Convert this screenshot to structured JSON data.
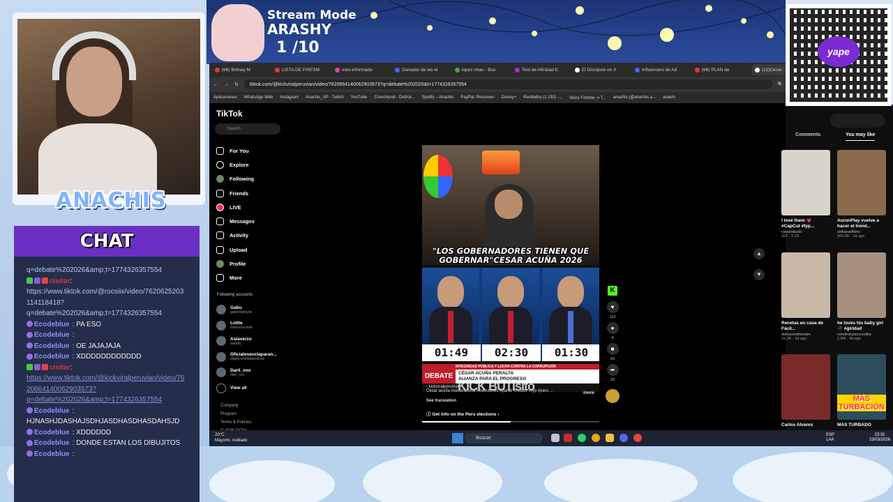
{
  "overlay": {
    "stream_title": "Stream Mode",
    "streamer": "ARASHY",
    "count": "1  /10",
    "name_banner": "ANACHIS",
    "payment_brand": "yape"
  },
  "chat": {
    "title": "CHAT",
    "messages": [
      {
        "user": "",
        "text": "q=debate%202026&amp;t=1774326357554",
        "kind": "link"
      },
      {
        "user": "cisitar",
        "text": ":",
        "kind": "red"
      },
      {
        "user": "",
        "text": "https://www.tiktok.com/@rocsiix/video/7620625203114118418?",
        "kind": "link"
      },
      {
        "user": "",
        "text": "q=debate%202026&amp;t=1774326357554",
        "kind": "link"
      },
      {
        "user": "Ecodeblue",
        "text": ": PA ESO",
        "kind": "normal"
      },
      {
        "user": "Ecodeblue",
        "text": ": ",
        "kind": "normal"
      },
      {
        "user": "Ecodeblue",
        "text": ": OE JAJAJAJA",
        "kind": "normal"
      },
      {
        "user": "Ecodeblue",
        "text": ": XDDDDDDDDDDDD",
        "kind": "normal"
      },
      {
        "user": "cisitar",
        "text": ":",
        "kind": "red"
      },
      {
        "user": "",
        "text": "https://www.tiktok.com/@kickviralperuvian/video/7620664140062903573?",
        "kind": "ulink"
      },
      {
        "user": "",
        "text": "q=debate%202026&amp;t=1774326357554",
        "kind": "ulink"
      },
      {
        "user": "Ecodeblue",
        "text": ":",
        "kind": "normal"
      },
      {
        "user": "",
        "text": "HJNASHJDASHAJSDHJASDHASDHASDAHSJD",
        "kind": "plain"
      },
      {
        "user": "Ecodeblue",
        "text": ": XDDDDDD",
        "kind": "normal"
      },
      {
        "user": "Ecodeblue",
        "text": ": DONDE ESTAN LOS DIBUJITOS",
        "kind": "normal"
      },
      {
        "user": "Ecodeblue",
        "text": ": ",
        "kind": "normal"
      }
    ]
  },
  "browser": {
    "tabs": [
      "(66) Britney M",
      "LISTA DE P.RESM",
      "voto-informado-",
      "Ganador de las el",
      "lopez chau - Bus",
      "Test de Afinidad E",
      "El Discípulo on X",
      "Influencers de Ad",
      "(66) PLAN de",
      "(12)Cesar"
    ],
    "url": "tiktok.com/@kickviralperuvian/video/7620664140062903573?q=debate%202026&t=1774326357554",
    "bookmarks": [
      "Aplicaciones",
      "WhatsApp Web",
      "Instagram",
      "Anachis_AP - Twitch",
      "YouTube",
      "Crunchyroll - Disfrut...",
      "Spotify – Anachis",
      "PayPal: Resumen",
      "Disney+",
      "Recibidos (1.192) -...",
      "Skins Fortnite ⇒ T...",
      "anachis (@anachis.a...",
      "anachi"
    ]
  },
  "tiktok": {
    "logo": "TikTok",
    "search_placeholder": "Search",
    "nav": [
      "For You",
      "Explore",
      "Following",
      "Friends",
      "LIVE",
      "Messages",
      "Activity",
      "Upload",
      "Profile",
      "More"
    ],
    "following_header": "Following accounts",
    "following": [
      {
        "name": "Gabu ",
        "handle": "gabrielaboyoé"
      },
      {
        "name": "Lottie ",
        "handle": "loveyoua.lottie"
      },
      {
        "name": "Aslaverzo ",
        "handle": "aslahly"
      },
      {
        "name": "Oficialesenclaparan...",
        "handle": "angelcordobataroficial"
      },
      {
        "name": "Daril_oxo",
        "handle": "daril_oxo"
      }
    ],
    "view_all": "View all",
    "footer": [
      "Company",
      "Program",
      "Terms & Policies",
      "© 2026 TikTok"
    ],
    "video": {
      "caption": "\"LOS GOBERNADORES TIENEN QUE GOBERNAR\"CESAR ACUÑA 2026",
      "timers": [
        "01:49",
        "02:30",
        "01:30"
      ],
      "banner_top": "INTEGRIDAD PÚBLICA Y LUCHA CONTRA LA CORRUPCIÓN",
      "banner_name": "CÉSAR ACUÑA PERALTA",
      "banner_party": "ALIANZA PARA EL PROGRESO",
      "banner_label": "DEBATE",
      "handle": "- kickviralperuvian",
      "watermark": "KICK  BUTIsito",
      "description": "Cesar acuña #cesaracuña #elecciones #parati #fotolor #fyp #peru ...",
      "more": "more",
      "see_translation": "See translation",
      "election_info": "Get info on the Peru elections",
      "progress": 0.5
    },
    "actions": {
      "likes": "112",
      "comments": "4",
      "saves": "10",
      "shares": "22"
    },
    "right_tabs": [
      "Comments",
      "You may like"
    ],
    "suggestions": [
      {
        "title": "I love them 💗 #CapCut #fyp...",
        "author": "rawandizzle",
        "meta": "323 · 1-16"
      },
      {
        "title": "AuronPlay vuelve a hacer el trend...",
        "author": "selhanalifilms",
        "meta": "506.6K · 1d ago"
      },
      {
        "title": "Recetas en casa de Fácil...",
        "author": "datoscreativostm",
        "meta": "31.2K · 1d ago"
      },
      {
        "title": "he loves his baby girl 🥀 #girldad",
        "author": "carolineissoccoolike",
        "meta": "2.8M · 4d ago"
      },
      {
        "title": "Carlos Alvares",
        "author": "",
        "meta": ""
      },
      {
        "title": "MÁS TURBADO",
        "author": "",
        "meta": ""
      }
    ],
    "thumb_label": "MÁS TURBACIÓN"
  },
  "taskbar": {
    "weather_temp": "20°C",
    "weather_desc": "Mayorm. nublado",
    "search": "Buscar",
    "lang1": "ESP",
    "lang2": "LAA",
    "time": "23:31",
    "date": "23/03/2026"
  },
  "colors": {
    "chat_header": "#6a2fc2",
    "chat_bg": "#252d4d",
    "kick_green": "#53fc18",
    "debate_red": "#c21b2a"
  }
}
